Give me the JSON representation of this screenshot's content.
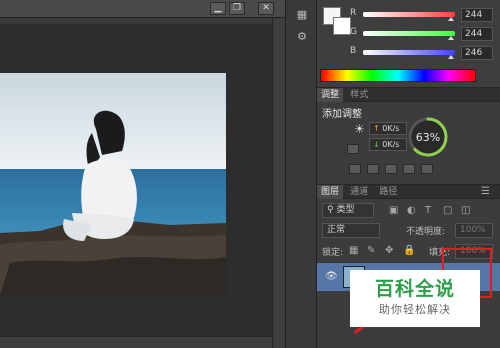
{
  "window": {
    "btn_min": "▁",
    "btn_restore": "❐",
    "btn_close": "✕"
  },
  "color": {
    "channels": [
      {
        "label": "R",
        "value": "244",
        "gradient_color": "#ff4040",
        "thumb": 0.96
      },
      {
        "label": "G",
        "value": "244",
        "gradient_color": "#40ff40",
        "thumb": 0.96
      },
      {
        "label": "B",
        "value": "246",
        "gradient_color": "#4040ff",
        "thumb": 0.96
      }
    ],
    "foreground": "#f4f4f6",
    "background": "#ffffff"
  },
  "adjust": {
    "tab_adjust": "调整",
    "tab_style": "样式",
    "title": "添加调整",
    "stat_up": "0K/s",
    "stat_down": "0K/s",
    "gauge": "63%",
    "gauge_value": 63
  },
  "layers": {
    "tab_layers": "图层",
    "tab_channels": "通道",
    "tab_paths": "路径",
    "filter_label": "类型",
    "blend_mode": "正常",
    "opacity_label": "不透明度:",
    "opacity_value": "100%",
    "lock_label": "锁定:",
    "fill_label": "填充:",
    "fill_value": "100%"
  },
  "watermark": {
    "title": "百科全说",
    "subtitle": "助你轻松解决"
  },
  "colors": {
    "highlight_red": "#e0201c",
    "gauge_green": "#8fd14f"
  }
}
